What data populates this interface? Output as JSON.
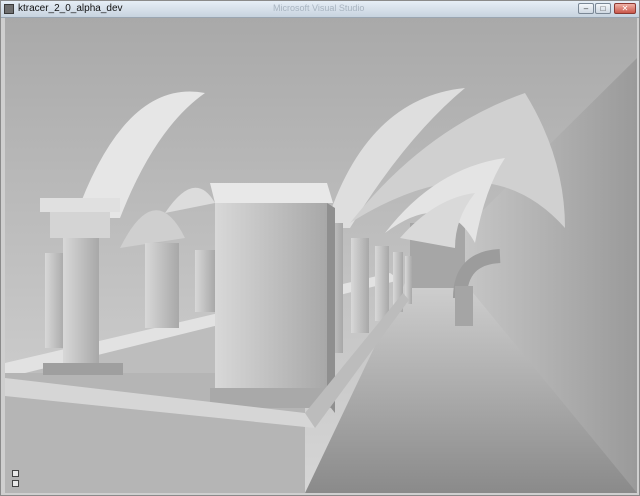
{
  "window": {
    "title": "ktracer_2_0_alpha_dev",
    "background_title": "Microsoft Visual Studio",
    "controls": {
      "minimize": "–",
      "maximize": "□",
      "close": "✕"
    }
  },
  "viewport": {
    "description_icon_names": [
      "gripper-icon",
      "gripper-icon"
    ]
  },
  "colors": {
    "titlebar_top": "#e6eef6",
    "titlebar_bottom": "#c7d3df",
    "scene_light": "#e8e8e8",
    "scene_mid": "#bdbdbd",
    "scene_dark": "#7f7f7f"
  }
}
